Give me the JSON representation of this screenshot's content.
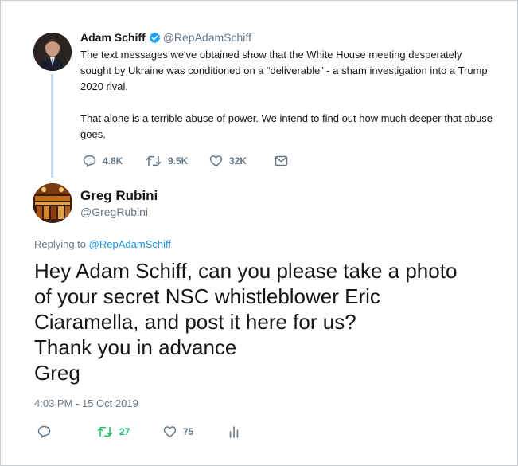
{
  "parent_tweet": {
    "display_name": "Adam Schiff",
    "handle": "@RepAdamSchiff",
    "paragraph_1": "The text messages we've obtained show that the White House meeting desperately sought by Ukraine was conditioned on a “deliverable” - a sham investigation into a Trump 2020 rival.",
    "paragraph_2": "That alone is a terrible abuse of power. We intend to find out how much deeper that abuse goes.",
    "reply_count": "4.8K",
    "retweet_count": "9.5K",
    "like_count": "32K",
    "icons": [
      "verified-badge-icon",
      "reply-icon",
      "retweet-icon",
      "like-icon",
      "message-icon"
    ]
  },
  "reply_tweet": {
    "display_name": "Greg Rubini",
    "handle": "@GregRubini",
    "replying_prefix": "Replying to",
    "replying_to": "@RepAdamSchiff",
    "text_lines": [
      "Hey Adam Schiff, can you please take a photo",
      "of your secret NSC whistleblower Eric",
      "Ciaramella, and post it here for us?",
      "Thank you in advance",
      "Greg"
    ],
    "timestamp": "4:03 PM - 15 Oct 2019",
    "retweet_count": "27",
    "like_count": "75",
    "icons": [
      "reply-icon",
      "retweet-icon",
      "like-icon",
      "analytics-icon"
    ]
  },
  "colors": {
    "link": "#1b95e0",
    "verified": "#1da1f2",
    "muted": "#657786",
    "retweet_active": "#17bf63",
    "thread_line": "#c4ddf0"
  }
}
